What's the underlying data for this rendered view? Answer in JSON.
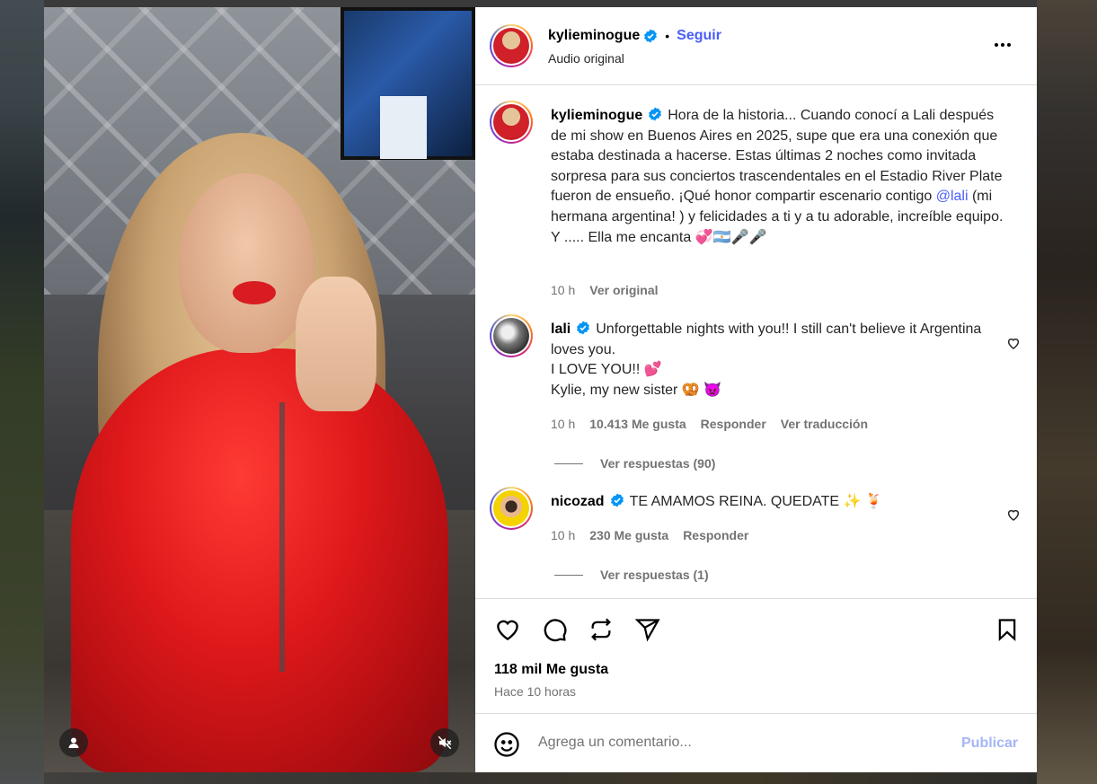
{
  "post": {
    "author": "kylieminogue",
    "follow_label": "Seguir",
    "separator": "•",
    "audio": "Audio original",
    "caption_parts": {
      "before_mention": "Hora de la historia... Cuando conocí a Lali después de mi show en Buenos Aires en 2025, supe que era una conexión que estaba destinada a hacerse. Estas últimas 2 noches como invitada sorpresa para sus conciertos trascendentales en el Estadio River Plate fueron de ensueño. ¡Qué honor compartir escenario contigo ",
      "mention": "@lali",
      "after_mention": " (mi hermana argentina! ) y felicidades a ti y a tu adorable, increíble equipo. Y ..... Ella me encanta 💞🇦🇷🎤🎤"
    },
    "caption_time": "10 h",
    "see_original": "Ver original",
    "likes": "118 mil Me gusta",
    "posted_ago": "Hace 10 horas"
  },
  "comments": [
    {
      "username": "lali",
      "text_lines": [
        "Unforgettable nights with you!! I still can't believe it Argentina loves you.",
        "I LOVE YOU!! 💕",
        "Kylie, my new sister 🥨 👿"
      ],
      "time": "10 h",
      "likes": "10.413 Me gusta",
      "reply_label": "Responder",
      "translate_label": "Ver traducción",
      "view_replies": "Ver respuestas (90)"
    },
    {
      "username": "nicozad",
      "text": "TE AMAMOS REINA. QUEDATE ✨ 🍹",
      "time": "10 h",
      "likes": "230 Me gusta",
      "reply_label": "Responder",
      "view_replies": "Ver respuestas (1)"
    }
  ],
  "composer": {
    "placeholder": "Agrega un comentario...",
    "publish_label": "Publicar"
  },
  "icons": {
    "like": "heart-icon",
    "comment": "comment-icon",
    "repost": "repost-icon",
    "share": "send-icon",
    "save": "bookmark-icon",
    "emoji": "emoji-icon",
    "more": "more-options-icon",
    "verified": "verified-badge-icon",
    "mute": "muted-audio-icon",
    "tagged_users": "user-icon"
  },
  "colors": {
    "accent": "#4a5df9",
    "verified": "#0095f6",
    "secondary_text": "#737373",
    "publish_disabled": "#a5b6f7"
  }
}
